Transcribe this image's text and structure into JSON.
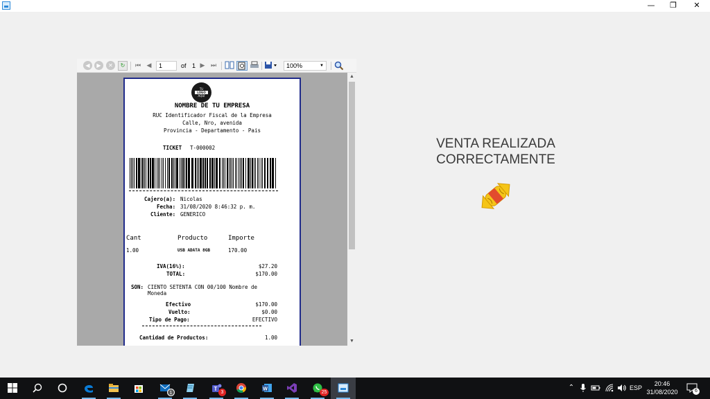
{
  "window": {
    "minimize_glyph": "—",
    "maximize_glyph": "❐",
    "close_glyph": "✕"
  },
  "toolbar": {
    "back_icon": "◀",
    "forward_icon": "▶",
    "stop_icon": "✕",
    "refresh_icon": "↻",
    "first_icon": "⏮",
    "prev_icon": "◀",
    "page_value": "1",
    "of_label": "of",
    "total_pages": "1",
    "next_icon": "▶",
    "last_icon": "⏭",
    "zoom_value": "100%"
  },
  "ticket": {
    "logo_lines": [
      "TU",
      "LOGO",
      "AQUÍ"
    ],
    "company_name": "NOMBRE DE TU EMPRESA",
    "ruc": "RUC Identificador Fiscal de la Empresa",
    "address": "Calle, Nro, avenida",
    "region": "Provincia - Departamento - Pais",
    "ticket_label": "TICKET",
    "ticket_number": "T-000002",
    "cashier_label": "Cajero(a):",
    "cashier_value": "Nicolas",
    "date_label": "Fecha:",
    "date_value": "31/08/2020 8:46:32 p. m.",
    "client_label": "Cliente:",
    "client_value": "GENERICO",
    "col_qty": "Cant",
    "col_product": "Producto",
    "col_amount": "Importe",
    "items": [
      {
        "qty": "1.00",
        "product": "USB ADATA 8GB",
        "amount": "170.00"
      }
    ],
    "iva_label": "IVA(16%):",
    "iva_value": "$27.20",
    "total_label": "TOTAL:",
    "total_value": "$170.00",
    "son_label": "SON:",
    "son_line1": "CIENTO SETENTA CON 00/100 Nombre de",
    "son_line2": "Moneda",
    "cash_label": "Efectivo",
    "cash_value": "$170.00",
    "change_label": "Vuelto:",
    "change_value": "$0.00",
    "paytype_label": "Tipo de Pago:",
    "paytype_value": "EFECTIVO",
    "count_label": "Cantidad de Productos:",
    "count_value": "1.00"
  },
  "message": {
    "line1": "VENTA REALIZADA",
    "line2": "CORRECTAMENTE"
  },
  "taskbar": {
    "icons": [
      "windows-start-icon",
      "search-icon",
      "cortana-icon",
      "edge-icon",
      "file-explorer-icon",
      "store-icon",
      "mail-icon",
      "notes-icon",
      "teams-icon",
      "chrome-icon",
      "word-icon",
      "visual-studio-icon",
      "whatsapp-icon",
      "app-window-icon"
    ],
    "mail_badge": "1",
    "teams_badge": "3",
    "whatsapp_badge": "25",
    "language": "ESP",
    "time": "20:46",
    "date": "31/08/2020",
    "notification_count": "6",
    "colors": {
      "edge": "#0a7bd6",
      "chrome": "#e8b00f",
      "word": "#2b5797",
      "vs": "#7b3fb7",
      "whatsapp": "#2fbe45",
      "teams": "#5059c9",
      "badge": "#e02424"
    }
  }
}
